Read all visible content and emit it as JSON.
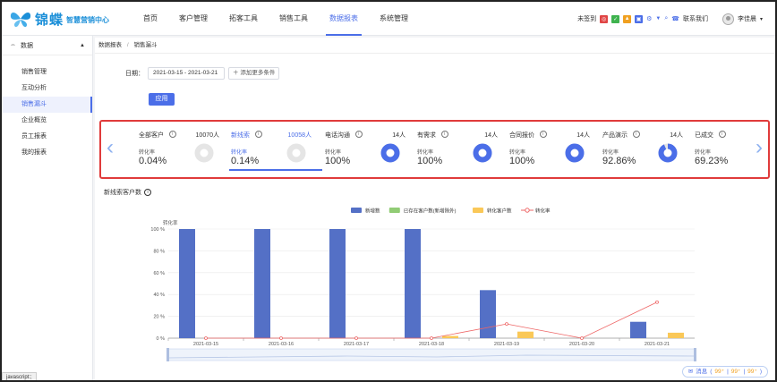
{
  "brand": {
    "name": "锦蝶",
    "subtitle": "智慧营销中心"
  },
  "nav": {
    "items": [
      "首页",
      "客户管理",
      "拓客工具",
      "销售工具",
      "数据报表",
      "系统管理"
    ],
    "active_index": 4,
    "right": {
      "checkin": "未签到",
      "contact": "联系我们",
      "user": "李佳晨"
    }
  },
  "sidebar": {
    "section": "数据",
    "items": [
      "销售管理",
      "互动分析",
      "销售漏斗",
      "企业概览",
      "员工报表",
      "我的报表"
    ],
    "active_index": 2
  },
  "status_bar": "javascript:;",
  "breadcrumb": {
    "root": "数据报表",
    "sep": "/",
    "current": "销售漏斗"
  },
  "filters": {
    "date_label": "日期：",
    "date_value": "2021-03-15 - 2021-03-21",
    "more": "添加更多条件",
    "apply": "应用"
  },
  "funnel": {
    "rate_label": "转化率",
    "stages": [
      {
        "name": "全部客户",
        "count": "10070人",
        "rate": "0.04%",
        "pct": 0.04,
        "active": false
      },
      {
        "name": "新线索",
        "count": "10058人",
        "rate": "0.14%",
        "pct": 0.14,
        "active": true
      },
      {
        "name": "电话沟通",
        "count": "14人",
        "rate": "100%",
        "pct": 100,
        "active": false
      },
      {
        "name": "有需求",
        "count": "14人",
        "rate": "100%",
        "pct": 100,
        "active": false
      },
      {
        "name": "合同报价",
        "count": "14人",
        "rate": "100%",
        "pct": 100,
        "active": false
      },
      {
        "name": "产品演示",
        "count": "14人",
        "rate": "92.86%",
        "pct": 92.86,
        "active": false
      },
      {
        "name": "已成交",
        "count": "",
        "rate": "69.23%",
        "pct": 69.23,
        "active": false
      }
    ]
  },
  "chart_data": {
    "type": "bar",
    "title": "新线索客户数",
    "ylabel": "转化率",
    "ylim": [
      0,
      100
    ],
    "yticks": [
      "0 %",
      "20 %",
      "40 %",
      "60 %",
      "80 %",
      "100 %"
    ],
    "categories": [
      "2021-03-15",
      "2021-03-16",
      "2021-03-17",
      "2021-03-18",
      "2021-03-19",
      "2021-03-20",
      "2021-03-21"
    ],
    "series": [
      {
        "name": "新增数",
        "type": "bar",
        "color": "#5470c6",
        "values": [
          100,
          100,
          100,
          100,
          44,
          0,
          15
        ]
      },
      {
        "name": "已存在客户数(新增除外)",
        "type": "bar",
        "color": "#91cc75",
        "values": [
          0,
          0,
          0,
          0,
          0,
          0,
          0
        ]
      },
      {
        "name": "转化客户数",
        "type": "bar",
        "color": "#fac858",
        "values": [
          0,
          0,
          0,
          2,
          6,
          0,
          5
        ]
      },
      {
        "name": "转化率",
        "type": "line",
        "color": "#ee6666",
        "values": [
          0,
          0,
          0,
          0,
          13,
          0,
          33
        ]
      }
    ],
    "legend_position": "top-center",
    "grid": true
  },
  "message": {
    "label": "消息",
    "a": "99⁺",
    "b": "99⁺",
    "c": "99⁺"
  },
  "colors": {
    "accent": "#4b6ee8",
    "highlight_border": "#e03b3b",
    "ring_bg": "#e5e5e5"
  }
}
